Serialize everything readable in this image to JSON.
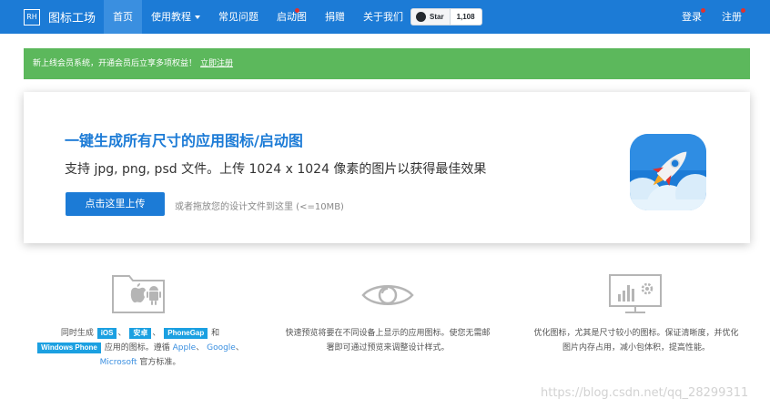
{
  "brand": {
    "logo": "RH",
    "name": "图标工场"
  },
  "nav": [
    {
      "label": "首页",
      "active": true
    },
    {
      "label": "使用教程",
      "dropdown": true
    },
    {
      "label": "常见问题"
    },
    {
      "label": "启动图",
      "badge": true
    },
    {
      "label": "捐赠"
    },
    {
      "label": "关于我们"
    }
  ],
  "github": {
    "star_label": "Star",
    "count": "1,108"
  },
  "nav_right": [
    {
      "label": "登录",
      "badge": true
    },
    {
      "label": "注册",
      "badge": true
    }
  ],
  "alert": {
    "text": "新上线会员系统，开通会员后立享多项权益！",
    "link": "立即注册"
  },
  "hero": {
    "title": "一键生成所有尺寸的应用图标/启动图",
    "subtitle": "支持 jpg, png, psd 文件。上传 1024 x 1024 像素的图片以获得最佳效果",
    "upload_button": "点击这里上传",
    "drag_hint": "或者拖放您的设计文件到这里 (<=10MB)"
  },
  "features": {
    "platforms": {
      "pre": "同时生成",
      "tag_ios": "iOS",
      "sep1": "、",
      "tag_android": "安卓",
      "sep2": "、",
      "tag_phonegap": "PhoneGap",
      "and": "和",
      "tag_wp": "Windows Phone",
      "mid": "应用的图标。遵循",
      "apple": "Apple",
      "comma1": "、",
      "google": "Google",
      "comma2": "、",
      "microsoft": "Microsoft",
      "post": "官方标准。"
    },
    "preview": {
      "line1": "快速预览将要在不同设备上显示的应用图标。使您无需邮",
      "line2": "署即可通过预览来调整设计样式。"
    },
    "optimize": {
      "line1": "优化图标，尤其是尺寸较小的图标。保证清晰度，并优化",
      "line2": "图片内存占用，减小包体积，提高性能。"
    }
  },
  "watermark": "https://blog.csdn.net/qq_28299311",
  "colors": {
    "primary": "#1c7bd6",
    "success": "#5cb85c",
    "tag": "#1ba0e1",
    "badge": "#e0322e"
  }
}
